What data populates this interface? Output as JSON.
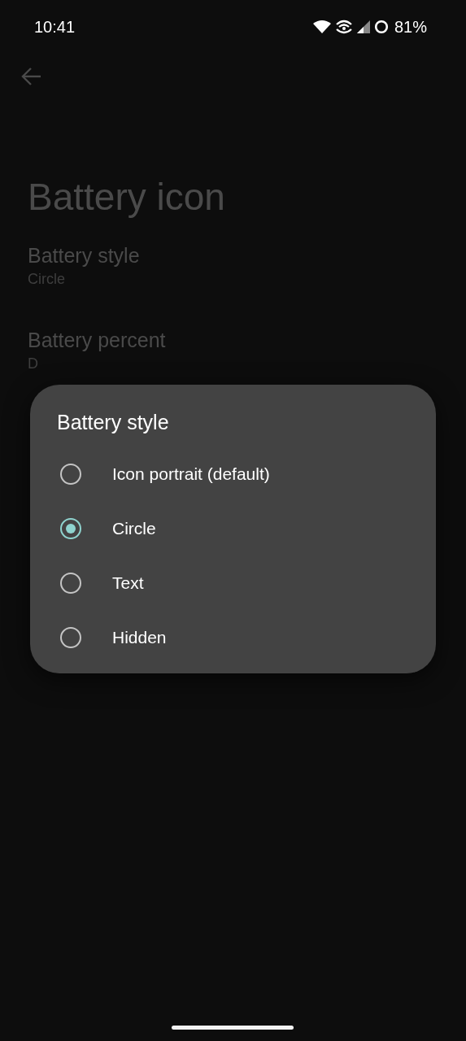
{
  "status_bar": {
    "time": "10:41",
    "battery_percent": "81%"
  },
  "page": {
    "title": "Battery icon",
    "settings": [
      {
        "title": "Battery style",
        "summary": "Circle"
      },
      {
        "title": "Battery percent",
        "summary": "D"
      }
    ]
  },
  "dialog": {
    "title": "Battery style",
    "options": [
      {
        "label": "Icon portrait (default)",
        "selected": false
      },
      {
        "label": "Circle",
        "selected": true
      },
      {
        "label": "Text",
        "selected": false
      },
      {
        "label": "Hidden",
        "selected": false
      }
    ]
  }
}
